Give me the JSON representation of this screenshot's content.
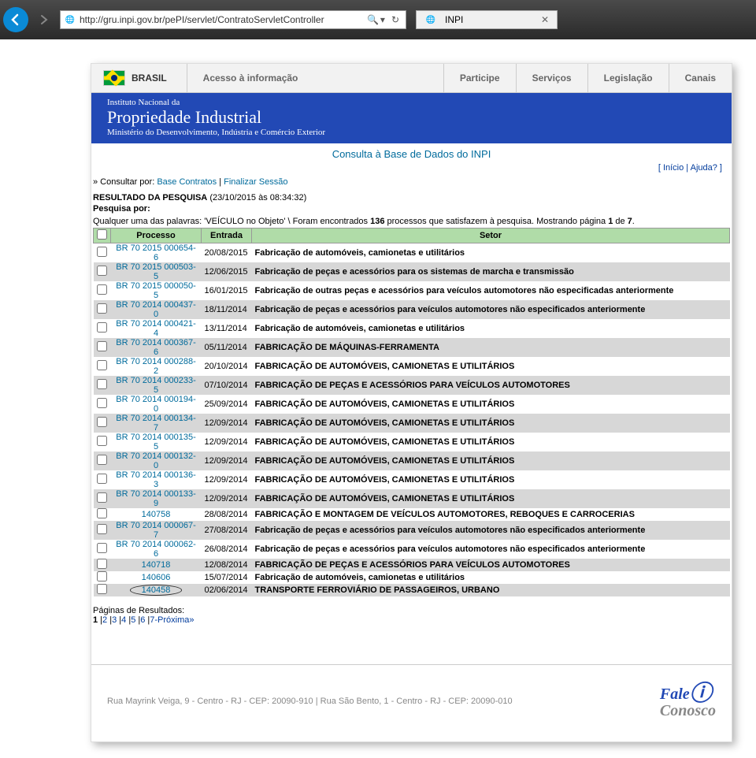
{
  "browser": {
    "url": "http://gru.inpi.gov.br/pePI/servlet/ContratoServletController",
    "tab_title": "INPI"
  },
  "topnav": {
    "brasil": "BRASIL",
    "acesso": "Acesso à informação",
    "links": [
      "Participe",
      "Serviços",
      "Legislação",
      "Canais"
    ]
  },
  "header": {
    "instituto": "Instituto Nacional da",
    "propriedade": "Propriedade Industrial",
    "ministerio": "Ministério do Desenvolvimento, Indústria e Comércio Exterior"
  },
  "consulta_title": "Consulta à Base de Dados do INPI",
  "right_links": {
    "inicio": "Início",
    "ajuda": "Ajuda?"
  },
  "consult": {
    "prefix": "» Consultar por: ",
    "base": "Base Contratos",
    "sep": " | ",
    "finalizar": "Finalizar Sessão"
  },
  "result": {
    "label": "RESULTADO DA PESQUISA",
    "ts": " (23/10/2015 às 08:34:32)",
    "pesquisa_por": "Pesquisa por:",
    "criteria_prefix": "Qualquer uma das palavras: 'VEÍCULO no Objeto' \\ Foram encontrados ",
    "found_n": "136",
    "criteria_mid": " processos que satisfazem à pesquisa. Mostrando página ",
    "page": "1",
    "of": " de ",
    "total_pages": "7",
    "dot": "."
  },
  "cols": {
    "processo": "Processo",
    "entrada": "Entrada",
    "setor": "Setor"
  },
  "rows": [
    {
      "alt": false,
      "proc": "BR 70 2015 000654-6",
      "ent": "20/08/2015",
      "setor": "Fabricação de automóveis, camionetas e utilitários"
    },
    {
      "alt": true,
      "proc": "BR 70 2015 000503-5",
      "ent": "12/06/2015",
      "setor": "Fabricação de peças e acessórios para os sistemas de marcha e transmissão"
    },
    {
      "alt": false,
      "proc": "BR 70 2015 000050-5",
      "ent": "16/01/2015",
      "setor": "Fabricação de outras peças e acessórios para veículos automotores não especificadas anteriormente"
    },
    {
      "alt": true,
      "proc": "BR 70 2014 000437-0",
      "ent": "18/11/2014",
      "setor": "Fabricação de peças e acessórios para veículos automotores não especificados anteriormente"
    },
    {
      "alt": false,
      "proc": "BR 70 2014 000421-4",
      "ent": "13/11/2014",
      "setor": "Fabricação de automóveis, camionetas e utilitários"
    },
    {
      "alt": true,
      "proc": "BR 70 2014 000367-6",
      "ent": "05/11/2014",
      "setor": "FABRICAÇÃO DE MÁQUINAS-FERRAMENTA"
    },
    {
      "alt": false,
      "proc": "BR 70 2014 000288-2",
      "ent": "20/10/2014",
      "setor": "FABRICAÇÃO DE AUTOMÓVEIS, CAMIONETAS E UTILITÁRIOS"
    },
    {
      "alt": true,
      "proc": "BR 70 2014 000233-5",
      "ent": "07/10/2014",
      "setor": "FABRICAÇÃO DE PEÇAS E ACESSÓRIOS PARA VEÍCULOS AUTOMOTORES"
    },
    {
      "alt": false,
      "proc": "BR 70 2014 000194-0",
      "ent": "25/09/2014",
      "setor": "FABRICAÇÃO DE AUTOMÓVEIS, CAMIONETAS E UTILITÁRIOS"
    },
    {
      "alt": true,
      "proc": "BR 70 2014 000134-7",
      "ent": "12/09/2014",
      "setor": "FABRICAÇÃO DE AUTOMÓVEIS, CAMIONETAS E UTILITÁRIOS"
    },
    {
      "alt": false,
      "proc": "BR 70 2014 000135-5",
      "ent": "12/09/2014",
      "setor": "FABRICAÇÃO DE AUTOMÓVEIS, CAMIONETAS E UTILITÁRIOS"
    },
    {
      "alt": true,
      "proc": "BR 70 2014 000132-0",
      "ent": "12/09/2014",
      "setor": "FABRICAÇÃO DE AUTOMÓVEIS, CAMIONETAS E UTILITÁRIOS"
    },
    {
      "alt": false,
      "proc": "BR 70 2014 000136-3",
      "ent": "12/09/2014",
      "setor": "FABRICAÇÃO DE AUTOMÓVEIS, CAMIONETAS E UTILITÁRIOS"
    },
    {
      "alt": true,
      "proc": "BR 70 2014 000133-9",
      "ent": "12/09/2014",
      "setor": "FABRICAÇÃO DE AUTOMÓVEIS, CAMIONETAS E UTILITÁRIOS"
    },
    {
      "alt": false,
      "proc": "140758",
      "ent": "28/08/2014",
      "setor": "FABRICAÇÃO E MONTAGEM DE VEÍCULOS AUTOMOTORES, REBOQUES E CARROCERIAS"
    },
    {
      "alt": true,
      "proc": "BR 70 2014 000067-7",
      "ent": "27/08/2014",
      "setor": "Fabricação de peças e acessórios para veículos automotores não especificados anteriormente"
    },
    {
      "alt": false,
      "proc": "BR 70 2014 000062-6",
      "ent": "26/08/2014",
      "setor": "Fabricação de peças e acessórios para veículos automotores não especificados anteriormente"
    },
    {
      "alt": true,
      "proc": "140718",
      "ent": "12/08/2014",
      "setor": "FABRICAÇÃO DE PEÇAS E ACESSÓRIOS PARA VEÍCULOS AUTOMOTORES"
    },
    {
      "alt": false,
      "proc": "140606",
      "ent": "15/07/2014",
      "setor": "Fabricação de automóveis, camionetas e utilitários"
    },
    {
      "alt": true,
      "proc": "140458",
      "ent": "02/06/2014",
      "setor": "TRANSPORTE FERROVIÁRIO DE PASSAGEIROS, URBANO",
      "circled": true
    }
  ],
  "pagination": {
    "label": "Páginas de Resultados:",
    "pages": [
      "1",
      "2",
      "3",
      "4",
      "5",
      "6",
      "7-Próxima»"
    ]
  },
  "footer": {
    "addr1": "Rua Mayrink Veiga, 9 - Centro - RJ - CEP: 20090-910",
    "sep": "   |   ",
    "addr2": "Rua São Bento, 1 - Centro - RJ - CEP: 20090-010",
    "fale": "Fale",
    "conosco": "Conosco"
  }
}
